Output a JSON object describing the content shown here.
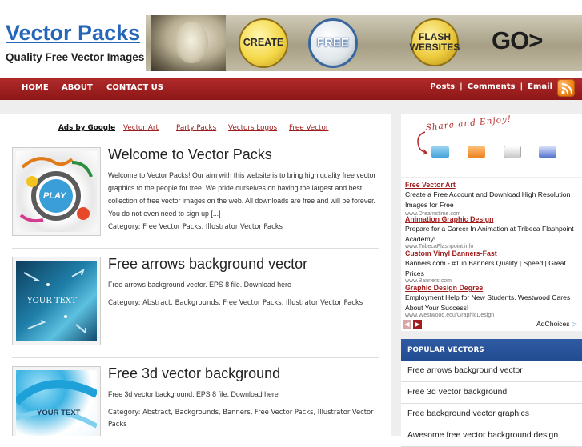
{
  "header": {
    "site_title": "Vector Packs",
    "tagline": "Quality Free Vector Images",
    "banner": {
      "badge_create": "CREATE",
      "badge_free": "FREE",
      "badge_flash": "FLASH WEBSITES",
      "go": "GO>"
    }
  },
  "nav": {
    "left": [
      "HOME",
      "ABOUT",
      "CONTACT US"
    ],
    "right": [
      "Posts",
      "Comments",
      "Email"
    ],
    "separator": "|",
    "rss_icon": "rss-icon"
  },
  "ad_links": {
    "label": "Ads by Google",
    "links": [
      "Vector Art",
      "Party Packs",
      "Vectors Logos",
      "Free Vector"
    ]
  },
  "posts": [
    {
      "title": "Welcome to Vector Packs",
      "excerpt": "Welcome to Vector Packs! Our aim with this website is to bring high quality free vector graphics to the people for free. We pride ourselves on having the largest and best collection of free vector images on the web. All downloads are free and will be forever. You do not even need to sign up [...]",
      "categories": "Category: Free Vector Packs, Illustrator Vector Packs",
      "thumb_text": "PLAY"
    },
    {
      "title": "Free arrows background vector",
      "excerpt": "Free arrows background vector. EPS 8 file. Download here",
      "categories": "Category: Abstract, Backgrounds, Free Vector Packs, Illustrator Vector Packs",
      "thumb_text": "YOUR TEXT"
    },
    {
      "title": "Free 3d vector background",
      "excerpt": "Free 3d vector background. EPS 8 file. Download here",
      "categories": "Category: Abstract, Backgrounds, Banners, Free Vector Packs, Illustrator Vector Packs",
      "thumb_text": "YOUR TEXT"
    }
  ],
  "sidebar": {
    "share_text": "Share and Enjoy!",
    "share_icons": [
      "twitter-icon",
      "rss-icon",
      "email-icon",
      "bookmark-icon"
    ],
    "ads": [
      {
        "title": "Free Vector Art",
        "desc": "Create a Free Account and Download High Resolution Images for Free",
        "url": "www.Dreamstime.com"
      },
      {
        "title": "Animation Graphic Design",
        "desc": "Prepare for a Career In Animation at Tribeca Flashpoint Academy!",
        "url": "www.TribecaFlashpoint.info"
      },
      {
        "title": "Custom Vinyl Banners-Fast",
        "desc": "Banners.com - #1 in Banners Quality | Speed | Great Prices",
        "url": "www.Banners.com"
      },
      {
        "title": "Graphic Design Degree",
        "desc": "Employment Help for New Students. Westwood Cares About Your Success!",
        "url": "www.Westwood.edu/GraphicDesign"
      }
    ],
    "adchoices": "AdChoices",
    "popular_title": "POPULAR VECTORS",
    "popular_items": [
      "Free arrows background vector",
      "Free 3d vector background",
      "Free background vector graphics",
      "Awesome free vector background design"
    ]
  },
  "colors": {
    "title_blue": "#2566b8",
    "nav_red": "#a02020",
    "link_red": "#a11d1d",
    "popular_blue": "#2f5ba3"
  }
}
